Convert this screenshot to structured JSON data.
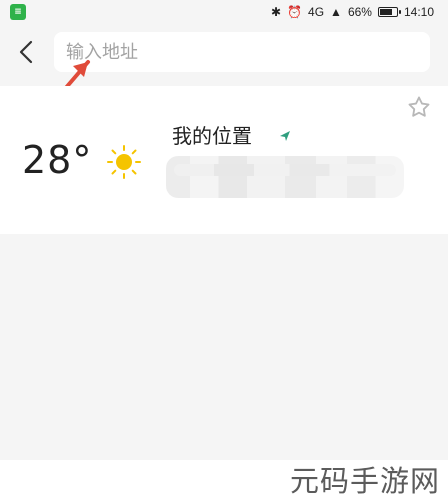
{
  "status_bar": {
    "battery_percent": "66%",
    "time": "14:10",
    "network_label": "4G",
    "app_badge_text": "≡"
  },
  "search": {
    "placeholder": "输入地址"
  },
  "weather": {
    "temperature": "28°",
    "location_title": "我的位置"
  },
  "watermark": {
    "text": "元码手游网"
  },
  "colors": {
    "accent_green": "#2fb24a",
    "sun_yellow": "#f5c400",
    "pin_green": "#2f9f7f",
    "annotation_red": "#e04b3a"
  }
}
